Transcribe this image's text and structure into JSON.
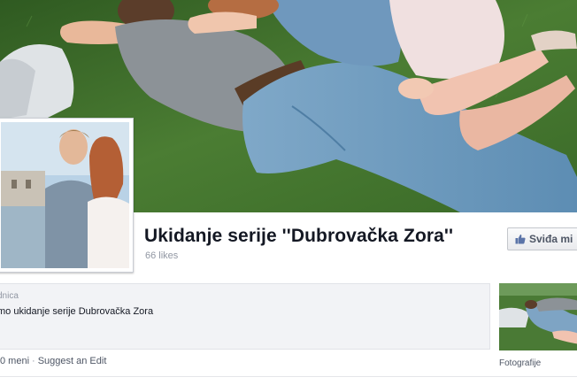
{
  "page": {
    "title": "Ukidanje serije ''Dubrovačka Zora''",
    "likes": "66 likes"
  },
  "actions": {
    "like_label": "Sviđa mi"
  },
  "about": {
    "heading": "dnica",
    "text": "mo ukidanje serije Dubrovačka Zora"
  },
  "meta": {
    "prefix": "0 meni",
    "separator": "·",
    "suggest_edit": "Suggest an Edit"
  },
  "photos": {
    "label": "Fotografije"
  },
  "colors": {
    "grass": "#3f6d2c",
    "denim": "#6e9ec0",
    "title": "#141823",
    "link": "#4e5665"
  },
  "icons": {
    "like": "thumbs-up-icon"
  }
}
